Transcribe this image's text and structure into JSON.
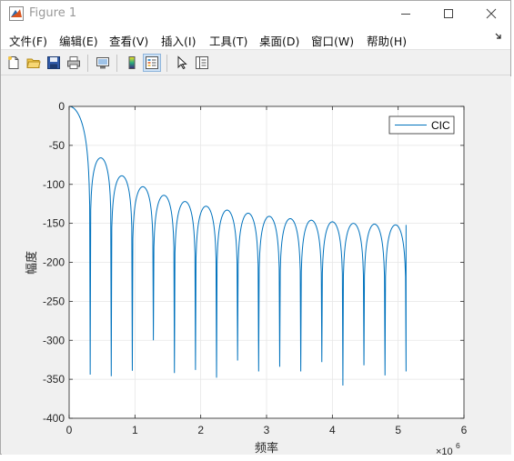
{
  "window": {
    "title": "Figure 1",
    "controls": {
      "minimize": "—",
      "maximize": "☐",
      "close": "✕"
    }
  },
  "menubar": {
    "items": [
      {
        "label": "文件(F)"
      },
      {
        "label": "编辑(E)"
      },
      {
        "label": "查看(V)"
      },
      {
        "label": "插入(I)"
      },
      {
        "label": "工具(T)"
      },
      {
        "label": "桌面(D)"
      },
      {
        "label": "窗口(W)"
      },
      {
        "label": "帮助(H)"
      }
    ],
    "overflow_icon": "arrow-icon"
  },
  "toolbar": {
    "buttons": [
      {
        "name": "new-figure",
        "icon": "new-file-icon"
      },
      {
        "name": "open-file",
        "icon": "folder-icon"
      },
      {
        "name": "save-figure",
        "icon": "floppy-icon"
      },
      {
        "name": "print-figure",
        "icon": "printer-icon"
      },
      {
        "name": "link-plot",
        "icon": "link-plot-icon"
      },
      {
        "name": "insert-colorbar",
        "icon": "colorbar-icon"
      },
      {
        "name": "insert-legend",
        "icon": "legend-icon",
        "pressed": true
      },
      {
        "name": "edit-plot",
        "icon": "cursor-arrow-icon"
      },
      {
        "name": "property-inspector",
        "icon": "property-inspector-icon"
      }
    ]
  },
  "chart_data": {
    "type": "line",
    "title": "",
    "xlabel": "频率",
    "ylabel": "幅度",
    "x_exponent_label": "×10^6",
    "xlim": [
      0,
      6
    ],
    "ylim": [
      -400,
      0
    ],
    "xticks": [
      0,
      1,
      2,
      3,
      4,
      5,
      6
    ],
    "yticks": [
      0,
      -50,
      -100,
      -150,
      -200,
      -250,
      -300,
      -350,
      -400
    ],
    "grid": true,
    "legend": {
      "position": "top-right",
      "entries": [
        "CIC"
      ]
    },
    "series": [
      {
        "name": "CIC",
        "color": "#0072bd",
        "x_end": 5.12,
        "notch_spacing": 0.32,
        "lobe_peaks": [
          -66,
          -89,
          -103,
          -114,
          -122,
          -128,
          -133,
          -137,
          -141,
          -144,
          -146,
          -148,
          -150,
          -151,
          -152,
          -152
        ],
        "notch_depths": [
          -344,
          -346,
          -339,
          -300,
          -342,
          -338,
          -348,
          -326,
          -340,
          -334,
          -340,
          -328,
          -358,
          -332,
          -345,
          -340
        ]
      }
    ]
  },
  "colors": {
    "window_bg": "#f0f0f0",
    "plot_bg": "#ffffff",
    "grid": "#e6e6e6",
    "line": "#0072bd"
  }
}
